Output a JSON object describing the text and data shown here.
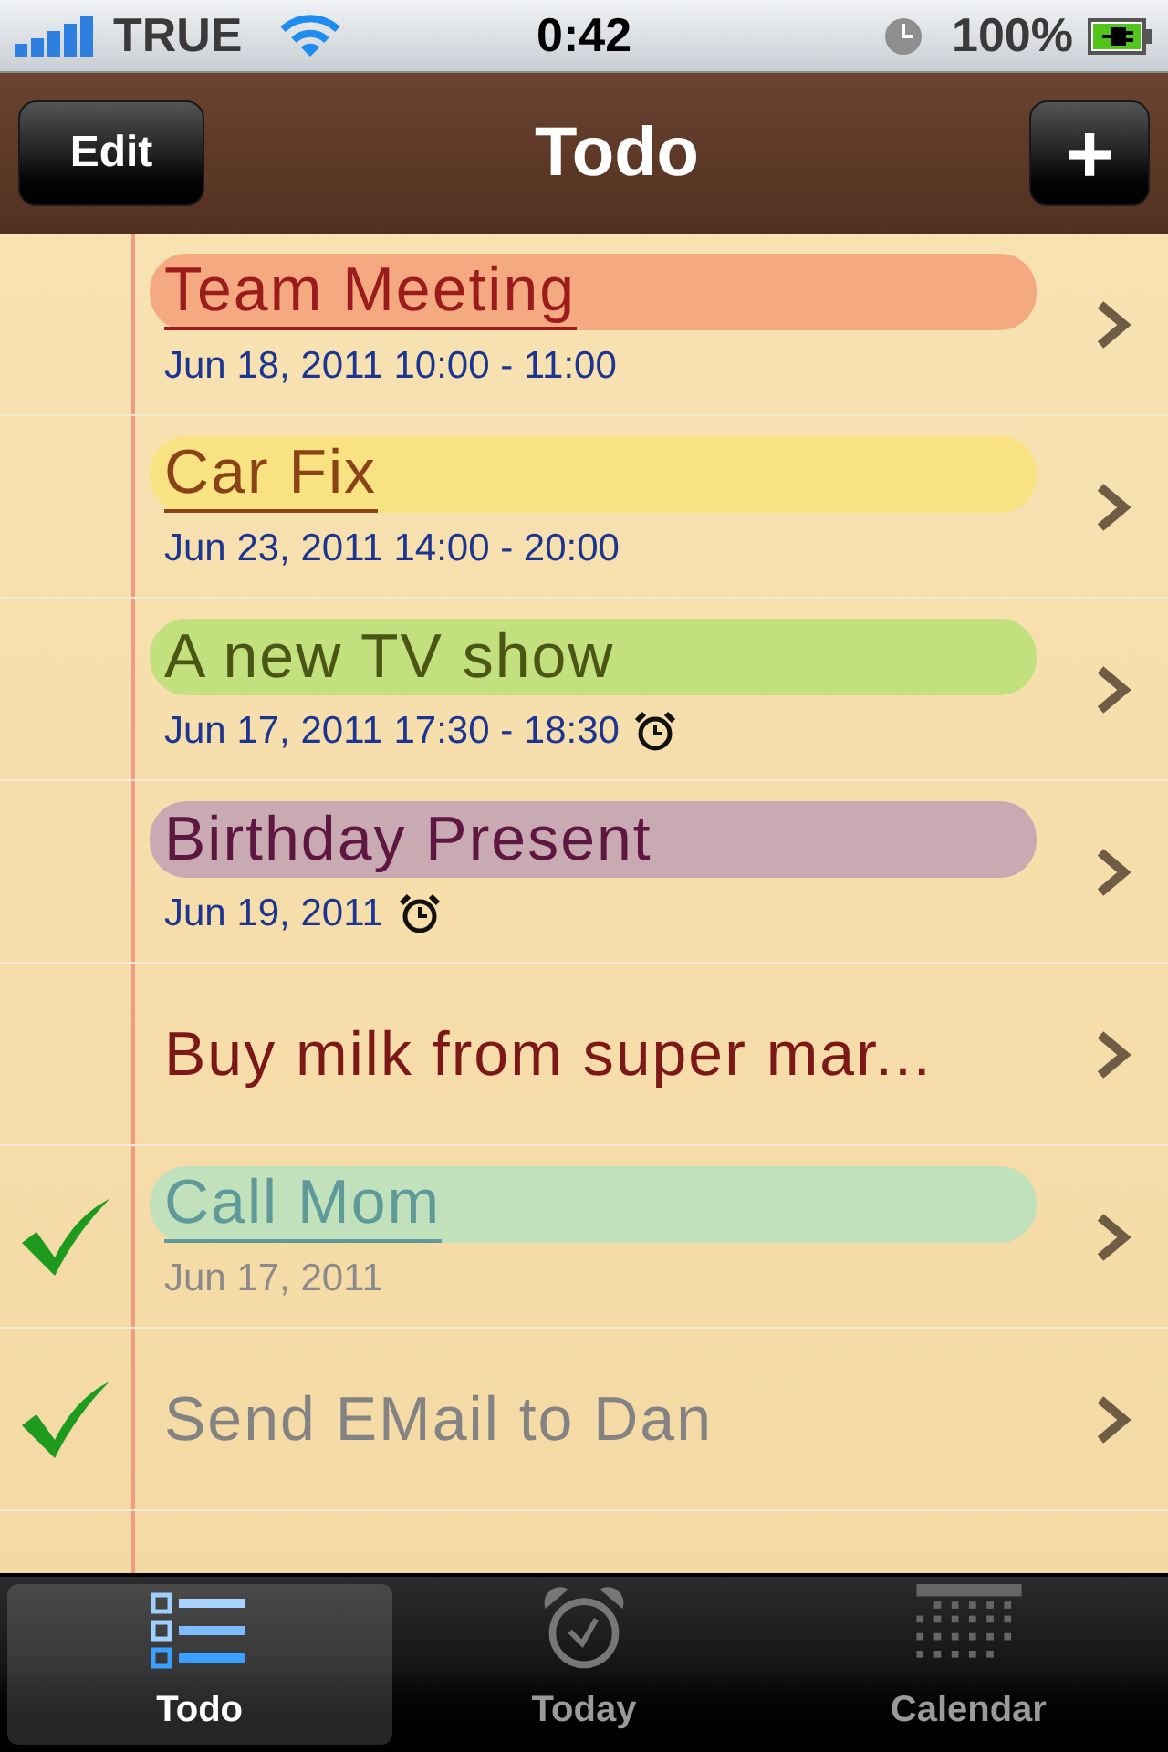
{
  "status_bar": {
    "carrier": "TRUE",
    "time": "0:42",
    "battery": "100%"
  },
  "nav_bar": {
    "left_button": "Edit",
    "title": "Todo",
    "right_button": "+"
  },
  "todos": [
    {
      "title": "Team Meeting",
      "highlight": {
        "color": "#f5a980"
      },
      "color": "#9b1c1c",
      "underlined": true,
      "date": "Jun 18, 2011 10:00 - 11:00",
      "alarm": false,
      "checked": false
    },
    {
      "title": "Car Fix",
      "highlight": {
        "color": "#f8e282"
      },
      "color": "#8a4316",
      "underlined": true,
      "date": "Jun 23, 2011 14:00 - 20:00",
      "alarm": false,
      "checked": false
    },
    {
      "title": "A new TV show",
      "highlight": {
        "color": "#c2e07e"
      },
      "color": "#4b5514",
      "underlined": false,
      "date": "Jun 17, 2011 17:30 - 18:30",
      "alarm": true,
      "checked": false
    },
    {
      "title": "Birthday Present",
      "highlight": {
        "color": "#c9aab2"
      },
      "color": "#5e1740",
      "underlined": false,
      "date": "Jun 19, 2011",
      "alarm": true,
      "checked": false
    },
    {
      "title": "Buy milk from super mar...",
      "color": "#7c1818",
      "underlined": false,
      "alarm": false,
      "checked": false
    },
    {
      "title": "Call Mom",
      "highlight": {
        "color": "#c1e0bc"
      },
      "color": "#5f9a98",
      "underlined": true,
      "date": "Jun 17, 2011",
      "alarm": false,
      "checked": true
    },
    {
      "title": "Send EMail to Dan",
      "color": "#838383",
      "underlined": false,
      "alarm": false,
      "checked": true
    }
  ],
  "tab_bar": [
    {
      "label": "Todo",
      "selected": true
    },
    {
      "label": "Today",
      "selected": false
    },
    {
      "label": "Calendar",
      "selected": false
    }
  ]
}
